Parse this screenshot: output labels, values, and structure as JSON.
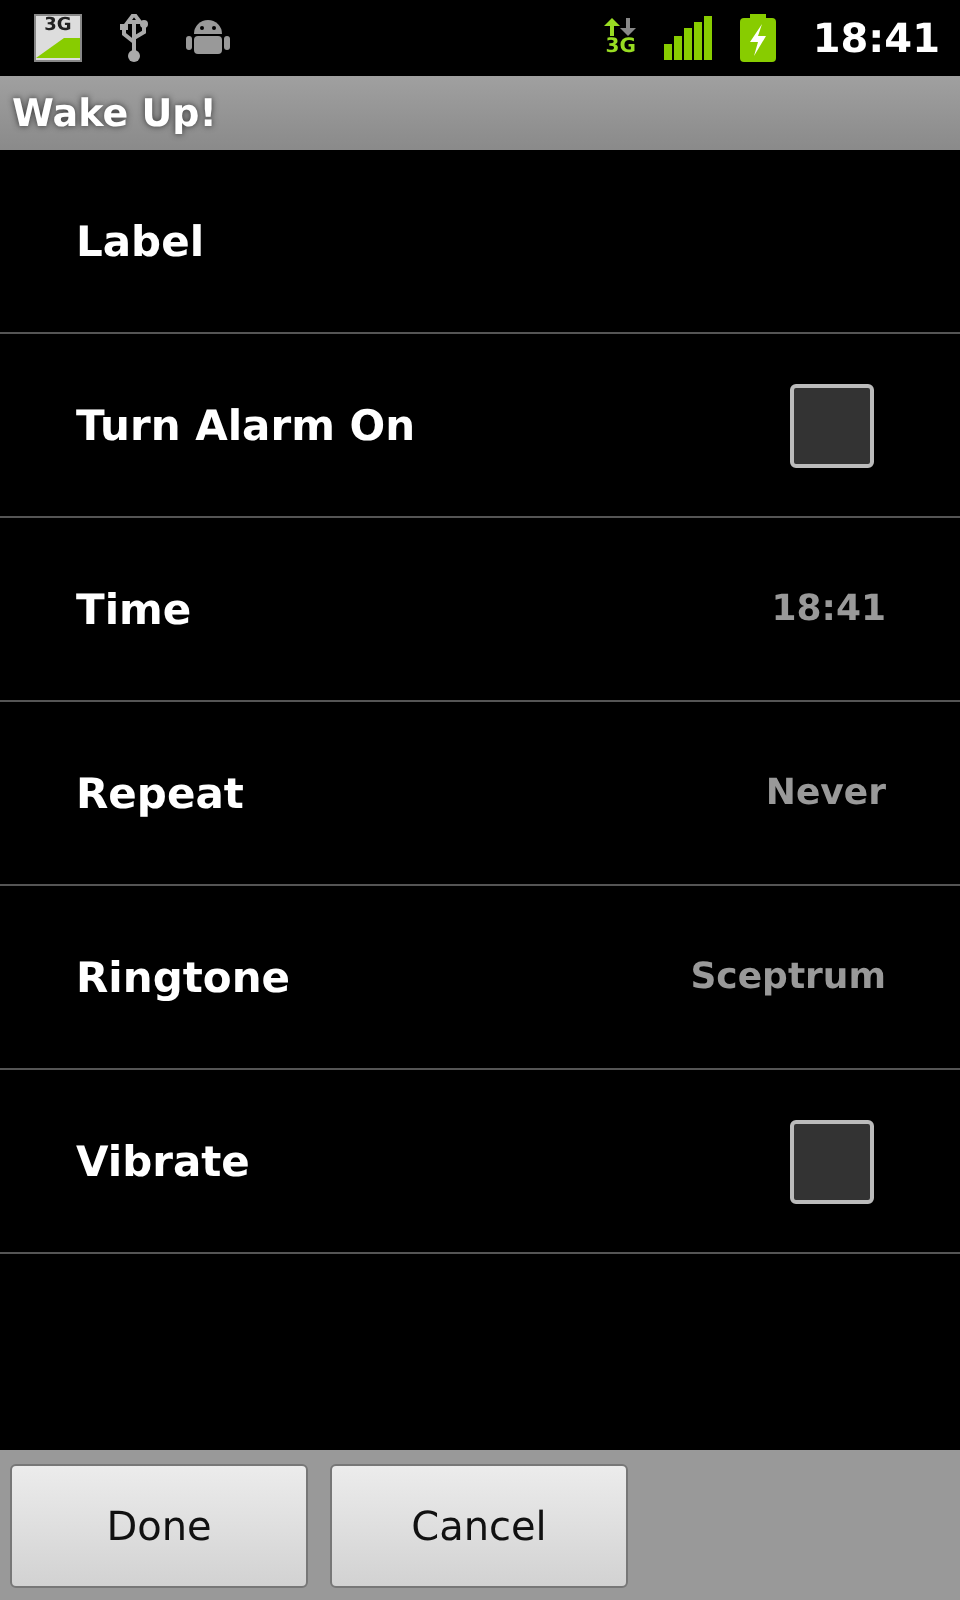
{
  "status_bar": {
    "sim_badge": "3G",
    "network_badge": "3G",
    "time": "18:41"
  },
  "window": {
    "title": "Wake Up!"
  },
  "settings": [
    {
      "kind": "plain",
      "label": "Label"
    },
    {
      "kind": "checkbox",
      "label": "Turn Alarm On",
      "checked": false
    },
    {
      "kind": "value",
      "label": "Time",
      "value": "18:41"
    },
    {
      "kind": "value",
      "label": "Repeat",
      "value": "Never"
    },
    {
      "kind": "value",
      "label": "Ringtone",
      "value": "Sceptrum"
    },
    {
      "kind": "checkbox",
      "label": "Vibrate",
      "checked": false
    }
  ],
  "buttons": [
    "Done",
    "Cancel"
  ]
}
